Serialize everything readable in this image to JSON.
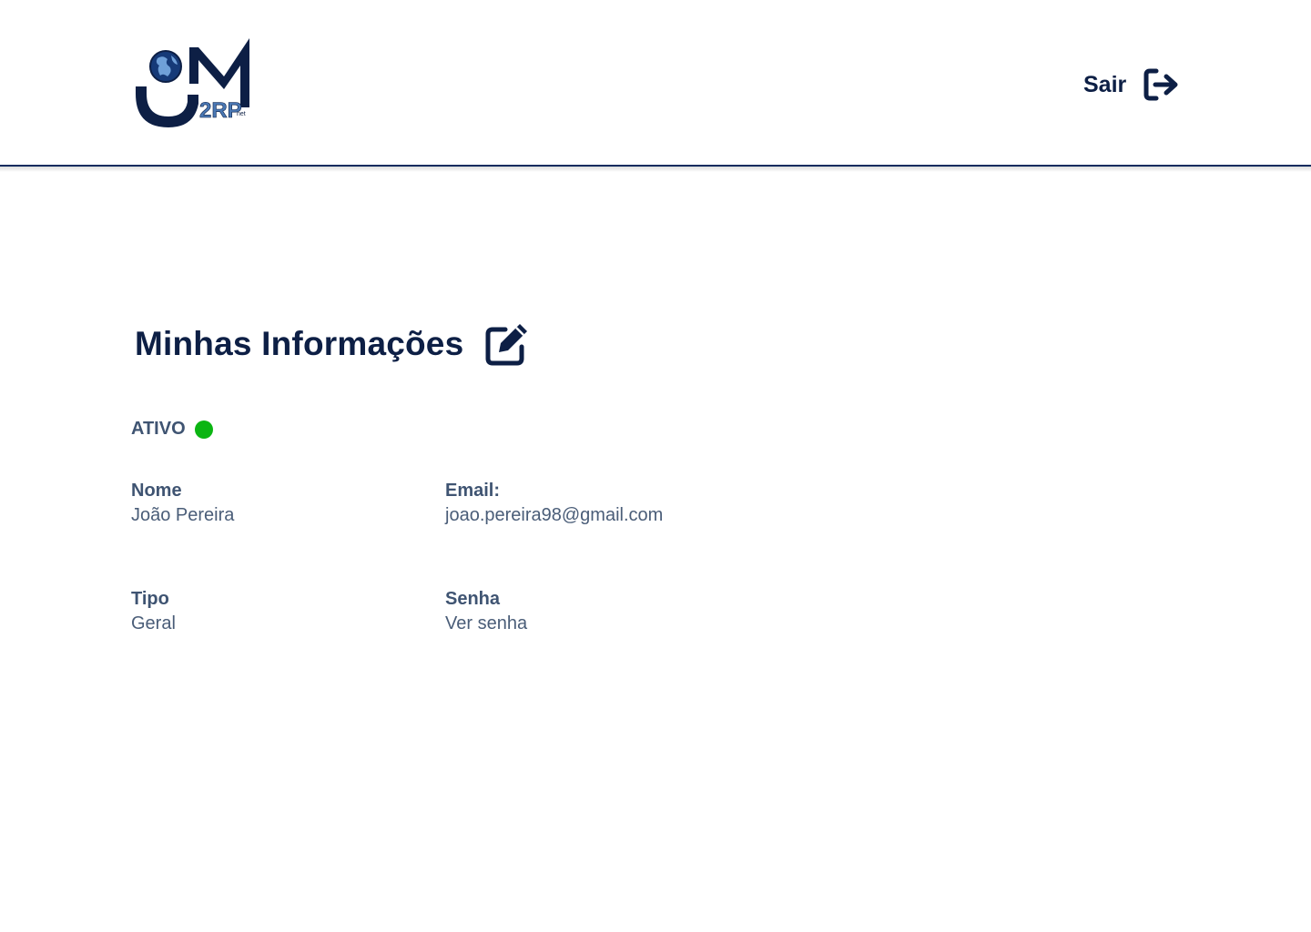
{
  "header": {
    "logo": {
      "icon": "jm-globe-logo",
      "badge_text": "2RP",
      "badge_suffix": "net",
      "colors": {
        "navy": "#0d1f45",
        "blue": "#4a78b4"
      }
    },
    "logout": {
      "label": "Sair",
      "icon": "sign-out-icon"
    }
  },
  "profile": {
    "title": "Minhas Informações",
    "edit_icon": "edit-pencil-icon",
    "status": {
      "label": "ATIVO",
      "color": "#0bb512"
    },
    "fields": {
      "nome": {
        "label": "Nome",
        "value": "João Pereira"
      },
      "email": {
        "label": "Email:",
        "value": "joao.pereira98@gmail.com"
      },
      "tipo": {
        "label": "Tipo",
        "value": "Geral"
      },
      "senha": {
        "label": "Senha",
        "value": "Ver senha"
      }
    }
  },
  "colors": {
    "primary_text": "#0d1f45",
    "secondary_text": "#3f5472",
    "header_line": "#0d2b5e"
  }
}
